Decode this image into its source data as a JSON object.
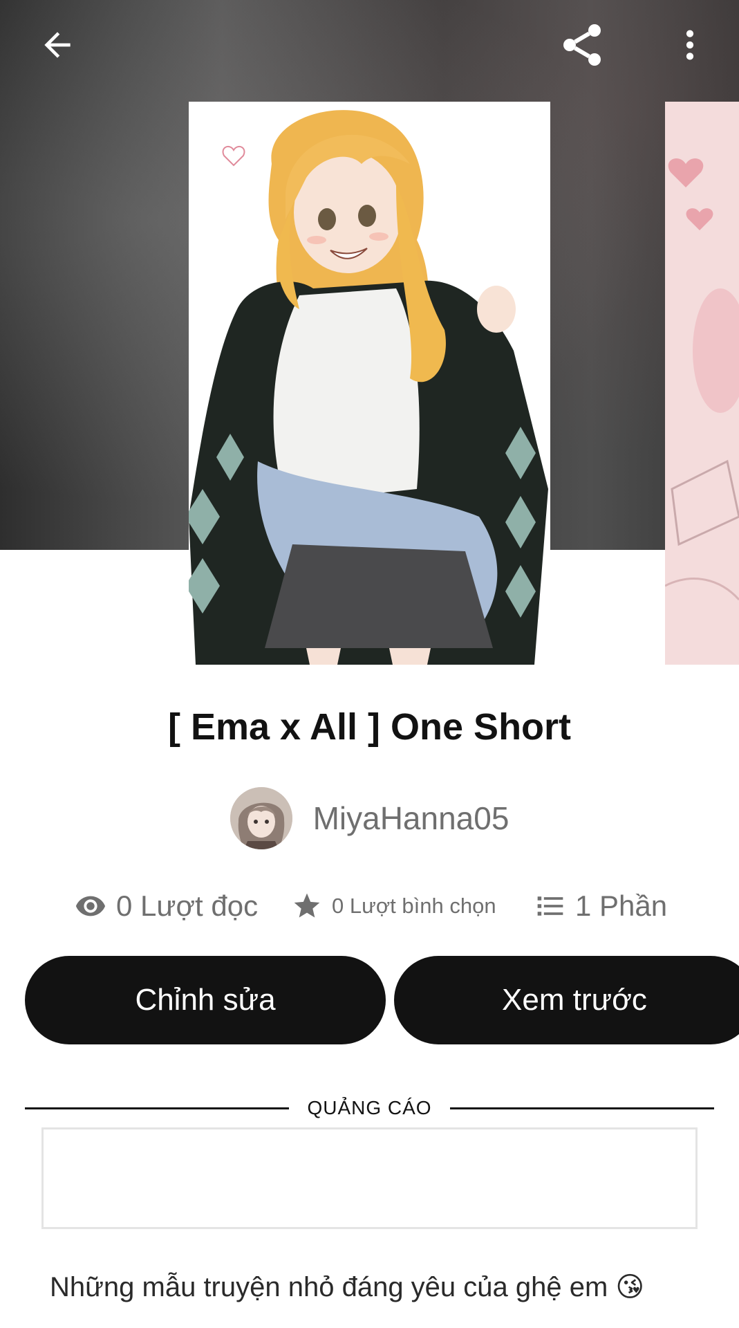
{
  "topbar": {
    "back_icon": "arrow-left-icon",
    "share_icon": "share-icon",
    "more_icon": "more-vertical-icon"
  },
  "story": {
    "title": "[ Ema x All ] One Short",
    "author": "MiyaHanna05",
    "stats": {
      "reads": "0 Lượt đọc",
      "votes": "0 Lượt bình chọn",
      "parts": "1 Phần"
    },
    "description": "Những mẫu truyện nhỏ đáng yêu của ghệ em 😘"
  },
  "actions": {
    "edit_label": "Chỉnh sửa",
    "preview_label": "Xem trước"
  },
  "ad": {
    "label": "QUẢNG CÁO"
  },
  "colors": {
    "button_bg": "#121212",
    "stat_text": "#6f6f6f"
  }
}
